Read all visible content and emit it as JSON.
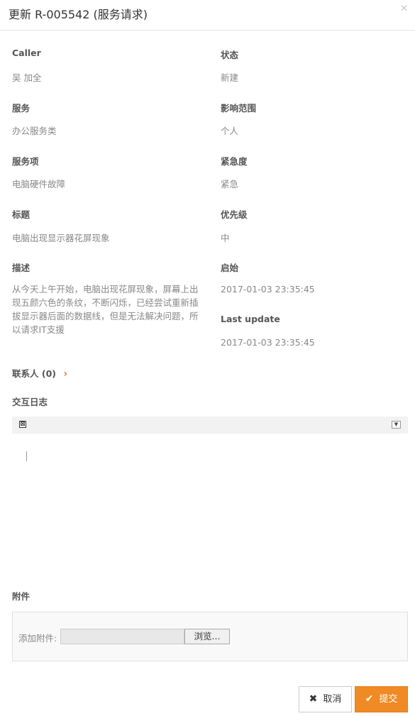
{
  "header": {
    "title": "更新 R-005542 (服务请求)",
    "close_icon": "×"
  },
  "fields": {
    "caller_label": "Caller",
    "caller_value": "吴 加全",
    "status_label": "状态",
    "status_value": "新建",
    "service_label": "服务",
    "service_value": "办公服务类",
    "impact_label": "影响范围",
    "impact_value": "个人",
    "service_item_label": "服务项",
    "service_item_value": "电脑硬件故障",
    "urgency_label": "紧急度",
    "urgency_value": "紧急",
    "title_label": "标题",
    "title_value": "电脑出现显示器花屏现象",
    "priority_label": "优先级",
    "priority_value": "中",
    "description_label": "描述",
    "description_value": "从今天上午开始，电脑出现花屏现象，屏幕上出现五颜六色的条纹，不断闪烁，已经尝试重新插拔显示器后面的数据线，但是无法解决问题，所以请求IT支援",
    "start_label": "启始",
    "start_value": "2017-01-03 23:35:45",
    "last_update_label": "Last update",
    "last_update_value": "2017-01-03 23:35:45"
  },
  "contacts": {
    "label": "联系人",
    "count": "(0)",
    "chevron": "›"
  },
  "log": {
    "label": "交互日志",
    "toolbar_icon": "⊠",
    "toolbar_dropdown": "▼"
  },
  "attachments": {
    "label": "附件",
    "add_label": "添加附件:",
    "browse_label": "浏览..."
  },
  "buttons": {
    "cancel_icon": "✖",
    "cancel_label": "取消",
    "submit_icon": "✔",
    "submit_label": "提交"
  },
  "colors": {
    "accent": "#f08a24",
    "chevron": "#e8791f"
  }
}
